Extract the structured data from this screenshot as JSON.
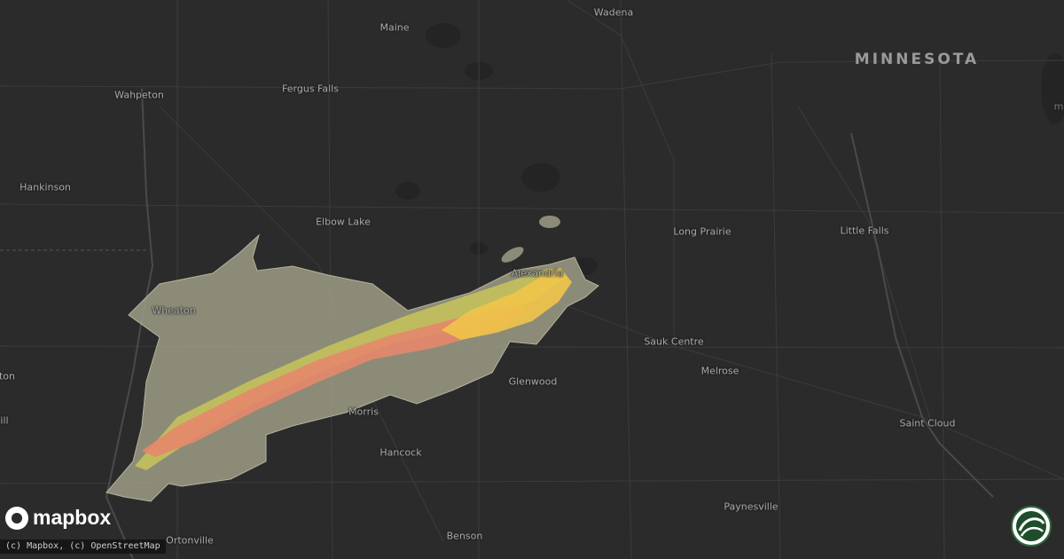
{
  "map": {
    "state_label": "MINNESOTA",
    "edge_label": "m",
    "cities": [
      {
        "id": "wadena",
        "name": "Wadena"
      },
      {
        "id": "maine",
        "name": "Maine"
      },
      {
        "id": "wahpeton",
        "name": "Wahpeton"
      },
      {
        "id": "fergus-falls",
        "name": "Fergus Falls"
      },
      {
        "id": "hankinson",
        "name": "Hankinson"
      },
      {
        "id": "elbow-lake",
        "name": "Elbow Lake"
      },
      {
        "id": "long-prairie",
        "name": "Long Prairie"
      },
      {
        "id": "little-falls",
        "name": "Little Falls"
      },
      {
        "id": "alexandria",
        "name": "Alexandria"
      },
      {
        "id": "wheaton",
        "name": "Wheaton"
      },
      {
        "id": "sauk-centre",
        "name": "Sauk Centre"
      },
      {
        "id": "melrose",
        "name": "Melrose"
      },
      {
        "id": "glenwood",
        "name": "Glenwood"
      },
      {
        "id": "morris",
        "name": "Morris"
      },
      {
        "id": "saint-cloud",
        "name": "Saint Cloud"
      },
      {
        "id": "hancock",
        "name": "Hancock"
      },
      {
        "id": "paynesville",
        "name": "Paynesville"
      },
      {
        "id": "benson",
        "name": "Benson"
      },
      {
        "id": "ortonville",
        "name": "Ortonville"
      },
      {
        "id": "left-ton",
        "name": "ton"
      },
      {
        "id": "left-ill",
        "name": "ill"
      }
    ],
    "swath_colors": {
      "outer": "#9e9c85",
      "band": "#c8c45a",
      "core": "#e5876a",
      "yellow": "#f0c44a"
    }
  },
  "logo": {
    "text": "mapbox"
  },
  "attribution": "(c) Mapbox, (c) OpenStreetMap",
  "brand_icon": "leaf-globe-icon"
}
